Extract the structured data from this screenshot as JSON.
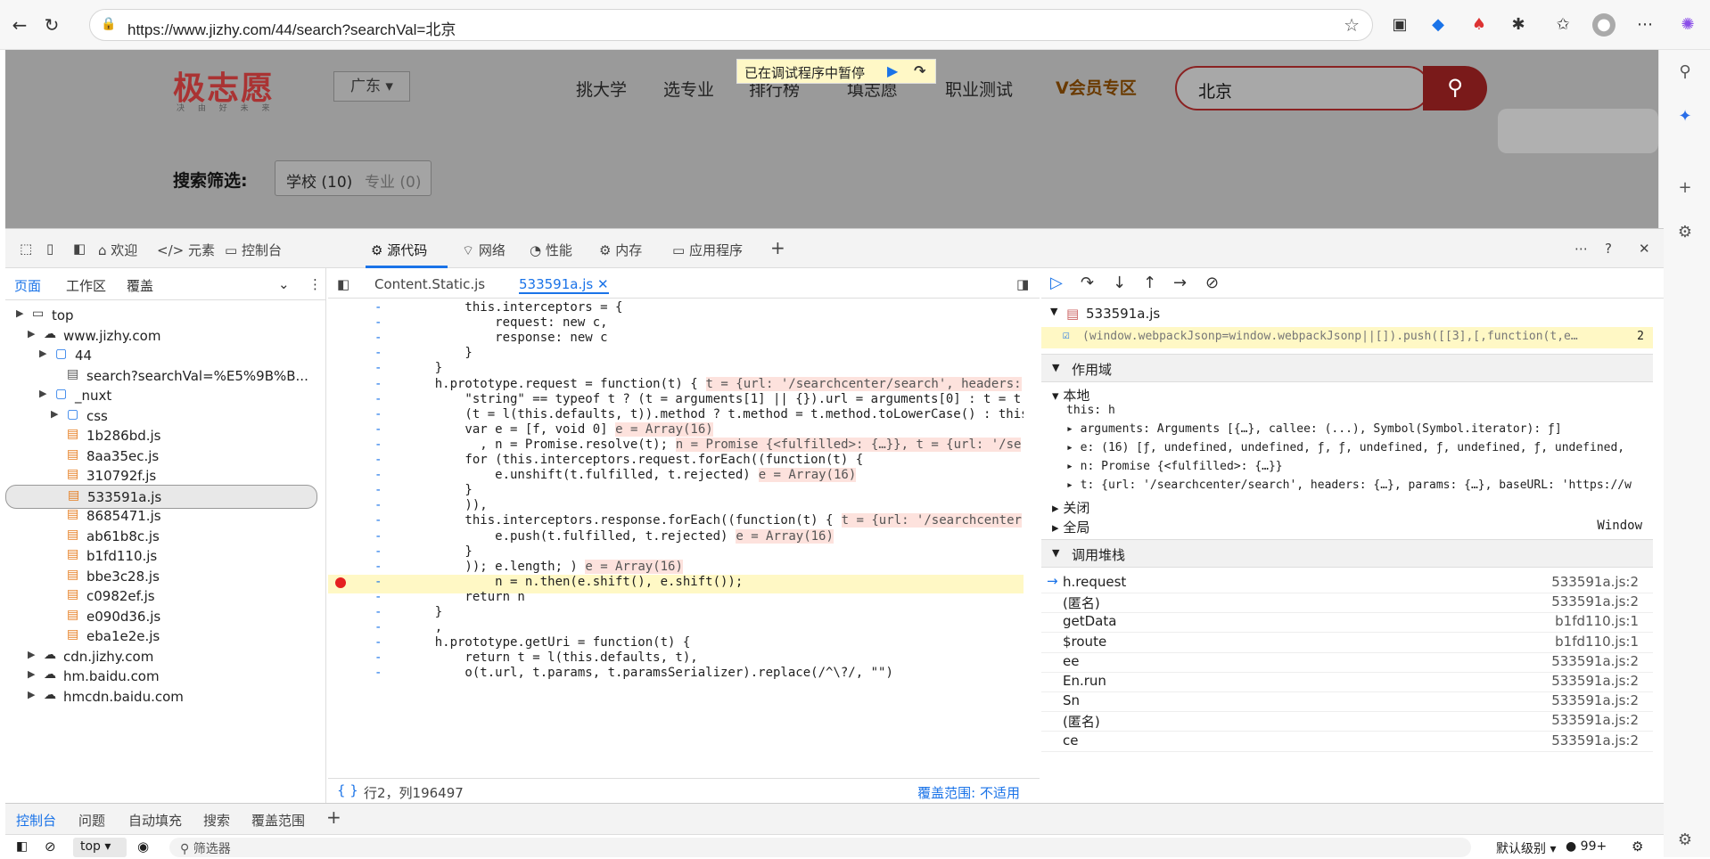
{
  "browser": {
    "url": "https://www.jizhy.com/44/search?searchVal=北京"
  },
  "site": {
    "logo": "极志愿",
    "logo_sub": "决 由 好 未 来",
    "province": "广东 ▾",
    "nav": [
      "挑大学",
      "选专业",
      "排行榜",
      "填志愿",
      "职业测试"
    ],
    "vip": "会员专区",
    "search_value": "北京",
    "filter_label": "搜索筛选:",
    "filter_school": "学校 (10)",
    "filter_major": "专业 (0)",
    "paused_banner": "已在调试程序中暂停"
  },
  "devtools": {
    "tabs": [
      "欢迎",
      "元素",
      "控制台",
      "源代码",
      "网络",
      "性能",
      "内存",
      "应用程序"
    ],
    "left_tabs": [
      "页面",
      "工作区",
      "覆盖"
    ],
    "tree": [
      {
        "label": "top",
        "indent": 0,
        "icon": "frame"
      },
      {
        "label": "www.jizhy.com",
        "indent": 1,
        "icon": "cloud"
      },
      {
        "label": "44",
        "indent": 2,
        "icon": "folder"
      },
      {
        "label": "search?searchVal=%E5%9B%B...",
        "indent": 3,
        "icon": "file"
      },
      {
        "label": "_nuxt",
        "indent": 2,
        "icon": "folder"
      },
      {
        "label": "css",
        "indent": 3,
        "icon": "folder"
      },
      {
        "label": "1b286bd.js",
        "indent": 3,
        "icon": "js"
      },
      {
        "label": "8aa35ec.js",
        "indent": 3,
        "icon": "js"
      },
      {
        "label": "310792f.js",
        "indent": 3,
        "icon": "js"
      },
      {
        "label": "533591a.js",
        "indent": 3,
        "icon": "js",
        "selected": true
      },
      {
        "label": "8685471.js",
        "indent": 3,
        "icon": "js"
      },
      {
        "label": "ab61b8c.js",
        "indent": 3,
        "icon": "js"
      },
      {
        "label": "b1fd110.js",
        "indent": 3,
        "icon": "js"
      },
      {
        "label": "bbe3c28.js",
        "indent": 3,
        "icon": "js"
      },
      {
        "label": "c0982ef.js",
        "indent": 3,
        "icon": "js"
      },
      {
        "label": "e090d36.js",
        "indent": 3,
        "icon": "js"
      },
      {
        "label": "eba1e2e.js",
        "indent": 3,
        "icon": "js"
      },
      {
        "label": "cdn.jizhy.com",
        "indent": 1,
        "icon": "cloud"
      },
      {
        "label": "hm.baidu.com",
        "indent": 1,
        "icon": "cloud"
      },
      {
        "label": "hmcdn.baidu.com",
        "indent": 1,
        "icon": "cloud"
      }
    ],
    "editor_tabs": [
      "Content.Static.js",
      "533591a.js"
    ],
    "code_lines": [
      {
        "t": "        this.interceptors = {",
        "v": ""
      },
      {
        "t": "            request: new c,",
        "v": ""
      },
      {
        "t": "            response: new c",
        "v": ""
      },
      {
        "t": "        }",
        "v": ""
      },
      {
        "t": "    }",
        "v": ""
      },
      {
        "t": "    h.prototype.request = function(t) {",
        "v": "t = {url: '/searchcenter/search', headers:"
      },
      {
        "t": "        \"string\" == typeof t ? (t = arguments[1] || {}).url = arguments[0] : t = t",
        "v": ""
      },
      {
        "t": "        (t = l(this.defaults, t)).method ? t.method = t.method.toLowerCase() : this.",
        "v": ""
      },
      {
        "t": "        var e = [f, void 0]",
        "v": "e = Array(16)"
      },
      {
        "t": "          , n = Promise.resolve(t);",
        "v": "n = Promise {<fulfilled>: {…}}, t = {url: '/se"
      },
      {
        "t": "        for (this.interceptors.request.forEach((function(t) {",
        "v": ""
      },
      {
        "t": "            e.unshift(t.fulfilled, t.rejected)",
        "v": "e = Array(16)"
      },
      {
        "t": "        }",
        "v": ""
      },
      {
        "t": "        )),",
        "v": ""
      },
      {
        "t": "        this.interceptors.response.forEach((function(t) {",
        "v": "t = {url: '/searchcenter"
      },
      {
        "t": "            e.push(t.fulfilled, t.rejected)",
        "v": "e = Array(16)"
      },
      {
        "t": "        }",
        "v": ""
      },
      {
        "t": "        )); e.length; )",
        "v": "e = Array(16)"
      },
      {
        "t": "            n = n.then(e.shift(), e.shift());",
        "v": "",
        "hl": true
      },
      {
        "t": "        return n",
        "v": ""
      },
      {
        "t": "    }",
        "v": ""
      },
      {
        "t": "    ,",
        "v": ""
      },
      {
        "t": "    h.prototype.getUri = function(t) {",
        "v": ""
      },
      {
        "t": "        return t = l(this.defaults, t),",
        "v": ""
      },
      {
        "t": "        o(t.url, t.params, t.paramsSerializer).replace(/^\\?/, \"\")",
        "v": ""
      }
    ],
    "status_pos": "行2，列196497",
    "coverage": "覆盖范围: 不适用",
    "paused_file": "533591a.js",
    "paused_line": "(window.webpackJsonp=window.webpackJsonp||[]).push([[3],[,function(t,e…",
    "paused_line_no": "2",
    "scope_title": "作用域",
    "scope_local": "本地",
    "scope_rows": [
      "this: h",
      "arguments: Arguments [{…}, callee: (...), Symbol(Symbol.iterator): ƒ]",
      "e: (16) [ƒ, undefined, undefined, ƒ, ƒ, undefined, ƒ, undefined, ƒ, undefined,",
      "n: Promise {<fulfilled>: {…}}",
      "t: {url: '/searchcenter/search', headers: {…}, params: {…}, baseURL: 'https://w"
    ],
    "scope_closure": "关闭",
    "scope_global": "全局",
    "scope_global_val": "Window",
    "callstack_title": "调用堆栈",
    "callstack": [
      {
        "fn": "h.request",
        "loc": "533591a.js:2"
      },
      {
        "fn": "(匿名)",
        "loc": "533591a.js:2"
      },
      {
        "fn": "getData",
        "loc": "b1fd110.js:1"
      },
      {
        "fn": "$route",
        "loc": "b1fd110.js:1"
      },
      {
        "fn": "ee",
        "loc": "533591a.js:2"
      },
      {
        "fn": "En.run",
        "loc": "533591a.js:2"
      },
      {
        "fn": "Sn",
        "loc": "533591a.js:2"
      },
      {
        "fn": "(匿名)",
        "loc": "533591a.js:2"
      },
      {
        "fn": "ce",
        "loc": "533591a.js:2"
      }
    ],
    "drawer_tabs": [
      "控制台",
      "问题",
      "自动填充",
      "搜索",
      "覆盖范围"
    ],
    "drawer_context": "top",
    "drawer_filter": "筛选器",
    "drawer_level": "默认级别",
    "drawer_count": "99+"
  }
}
